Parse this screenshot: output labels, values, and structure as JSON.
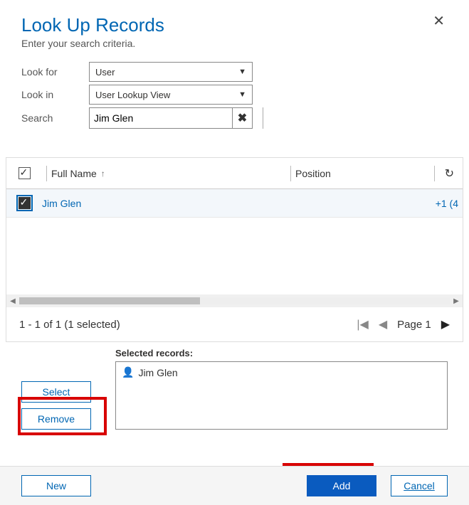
{
  "header": {
    "title": "Look Up Records",
    "subtitle": "Enter your search criteria."
  },
  "form": {
    "look_for_label": "Look for",
    "look_for_value": "User",
    "look_in_label": "Look in",
    "look_in_value": "User Lookup View",
    "search_label": "Search",
    "search_value": "Jim Glen"
  },
  "grid": {
    "columns": {
      "full_name": "Full Name",
      "position": "Position"
    },
    "rows": [
      {
        "full_name": "Jim Glen",
        "position": "",
        "phone": "+1 (4"
      }
    ]
  },
  "pager": {
    "status": "1 - 1 of 1 (1 selected)",
    "page_label": "Page 1"
  },
  "selected": {
    "label": "Selected records:",
    "items": [
      {
        "name": "Jim Glen"
      }
    ]
  },
  "buttons": {
    "select": "Select",
    "remove": "Remove",
    "new": "New",
    "add": "Add",
    "cancel": "Cancel"
  }
}
